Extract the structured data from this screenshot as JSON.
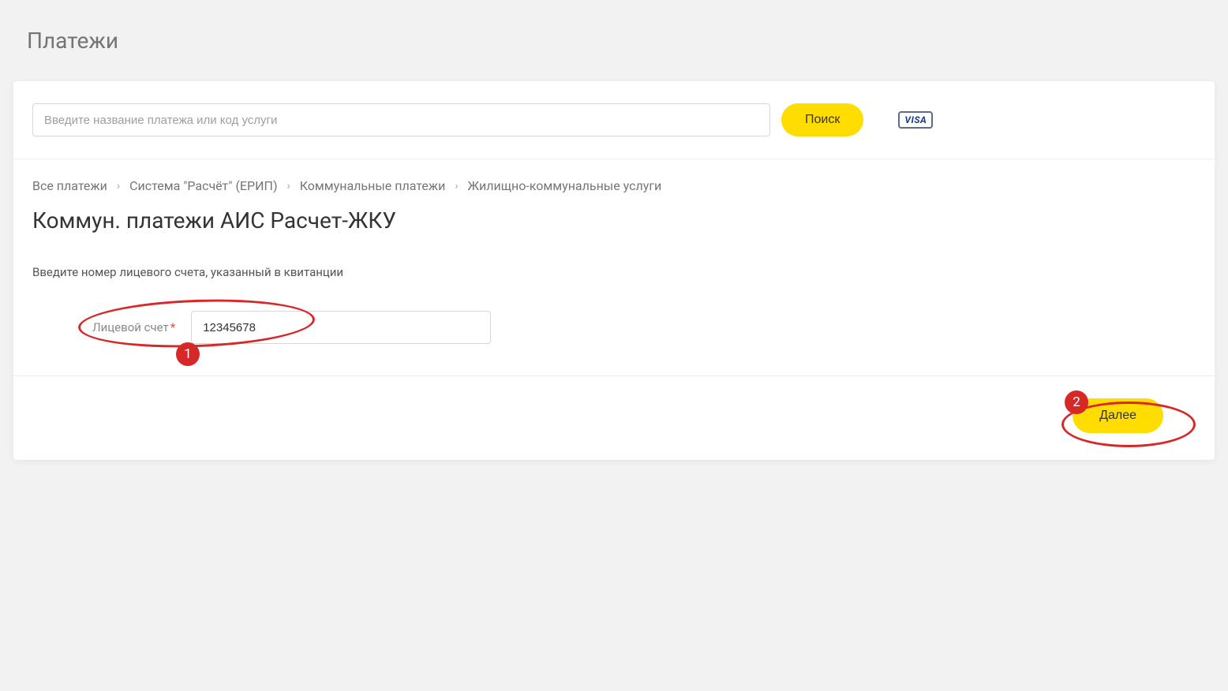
{
  "page_title": "Платежи",
  "search": {
    "placeholder": "Введите название платежа или код услуги",
    "button": "Поиск"
  },
  "visa_label": "VISA",
  "breadcrumb": {
    "items": [
      "Все платежи",
      "Система \"Расчёт\" (ЕРИП)",
      "Коммунальные платежи",
      "Жилищно-коммунальные услуги"
    ]
  },
  "section_title": "Коммун. платежи АИС Расчет-ЖКУ",
  "instruction": "Введите номер лицевого счета, указанный в квитанции",
  "form": {
    "account_label": "Лицевой счет",
    "required_mark": "*",
    "account_value": "12345678"
  },
  "actions": {
    "next": "Далее"
  },
  "annotations": {
    "badge1": "1",
    "badge2": "2"
  }
}
